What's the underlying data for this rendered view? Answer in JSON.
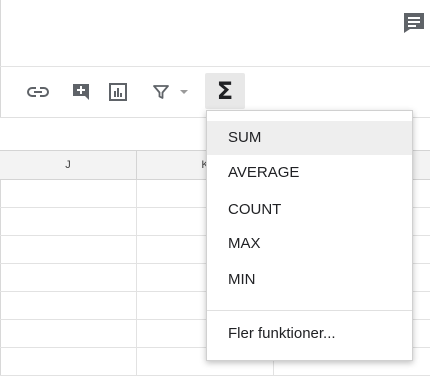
{
  "toolbar": {
    "link_icon": "link-icon",
    "comment_icon": "insert-comment-icon",
    "chart_icon": "insert-chart-icon",
    "filter_icon": "filter-icon",
    "filter_dropdown_icon": "chevron-down-icon",
    "functions_symbol": "Σ"
  },
  "top_icon": "comment-icon",
  "columns": [
    "J",
    "K"
  ],
  "functions_menu": {
    "items": [
      {
        "label": "SUM",
        "hovered": true
      },
      {
        "label": "AVERAGE",
        "hovered": false
      },
      {
        "label": "COUNT",
        "hovered": false
      },
      {
        "label": "MAX",
        "hovered": false
      },
      {
        "label": "MIN",
        "hovered": false
      }
    ],
    "more_label": "Fler funktioner..."
  },
  "colors": {
    "icon_gray": "#5f6368",
    "header_bg": "#f3f3f3",
    "hover_bg": "#eeeeee",
    "active_button_bg": "#e8e8e8"
  }
}
